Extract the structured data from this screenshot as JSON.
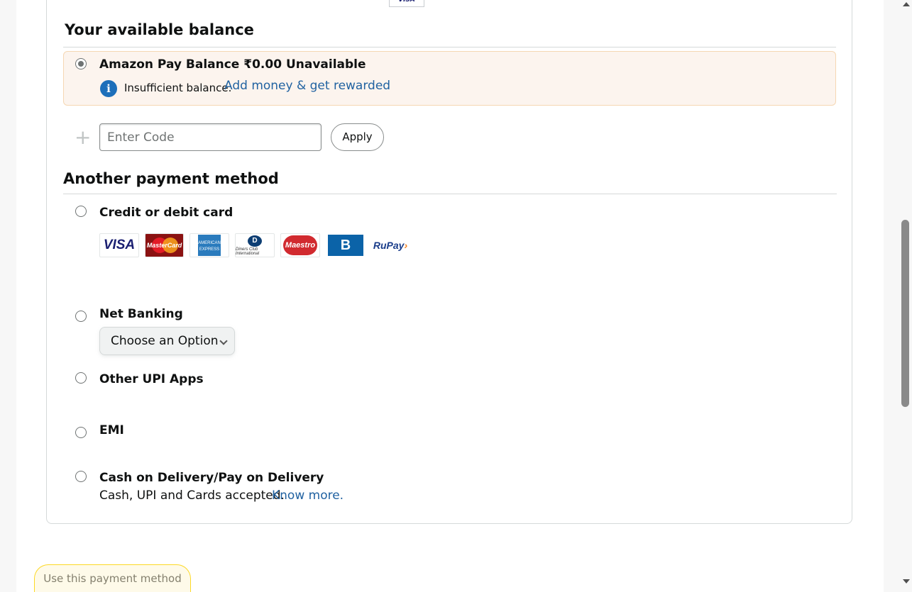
{
  "previous_card_logo": "VISA",
  "balance_section": {
    "title": "Your available balance",
    "amazon_pay_label": "Amazon Pay Balance",
    "amount": "₹0.00",
    "status": "Unavailable",
    "insufficient_text": "Insufficient balance.",
    "add_money_link": "Add money & get rewarded",
    "info_icon": "i"
  },
  "gift_code": {
    "plus_icon": "+",
    "placeholder": "Enter Code",
    "apply_label": "Apply"
  },
  "payment_section": {
    "title": "Another payment method",
    "methods": [
      {
        "label": "Credit or debit card"
      },
      {
        "label": "Net Banking"
      },
      {
        "label": "Other UPI Apps"
      },
      {
        "label": "EMI"
      },
      {
        "label": "Cash on Delivery/Pay on Delivery"
      }
    ],
    "card_logos": {
      "visa": "VISA",
      "mastercard": "MasterCard",
      "amex": "AMERICAN EXPRESS",
      "diners_symbol": "D",
      "diners": "Diners Club International",
      "maestro": "Maestro",
      "bajaj": "B",
      "rupay_main": "RuPay",
      "rupay_arrow": "›"
    },
    "net_banking_select": "Choose an Option",
    "cod_subtext": "Cash, UPI and Cards accepted.",
    "cod_link": "Know more."
  },
  "footer": {
    "use_button": "Use this payment method"
  },
  "colors": {
    "link": "#2162a1",
    "balance_bg": "#fcf4ee",
    "info_blue": "#1d6fba",
    "button_yellow": "#fcd200"
  }
}
